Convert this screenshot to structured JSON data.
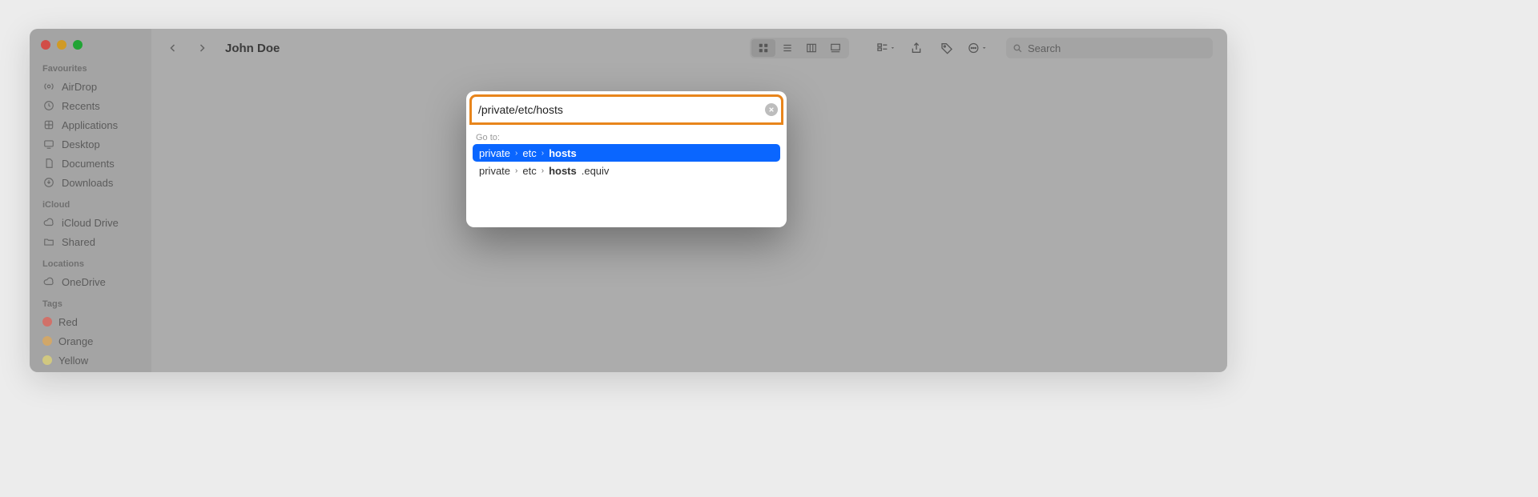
{
  "window": {
    "title": "John Doe"
  },
  "sidebar": {
    "sections": [
      {
        "head": "Favourites",
        "items": [
          "AirDrop",
          "Recents",
          "Applications",
          "Desktop",
          "Documents",
          "Downloads"
        ]
      },
      {
        "head": "iCloud",
        "items": [
          "iCloud Drive",
          "Shared"
        ]
      },
      {
        "head": "Locations",
        "items": [
          "OneDrive"
        ]
      },
      {
        "head": "Tags",
        "items": [
          "Red",
          "Orange",
          "Yellow"
        ]
      }
    ]
  },
  "search": {
    "placeholder": "Search"
  },
  "goto": {
    "input_value": "/private/etc/hosts",
    "label": "Go to:",
    "suggestions": [
      {
        "parts": [
          "private",
          "etc"
        ],
        "match": "hosts",
        "rest": "",
        "selected": true
      },
      {
        "parts": [
          "private",
          "etc"
        ],
        "match": "hosts",
        "rest": ".equiv",
        "selected": false
      }
    ]
  }
}
